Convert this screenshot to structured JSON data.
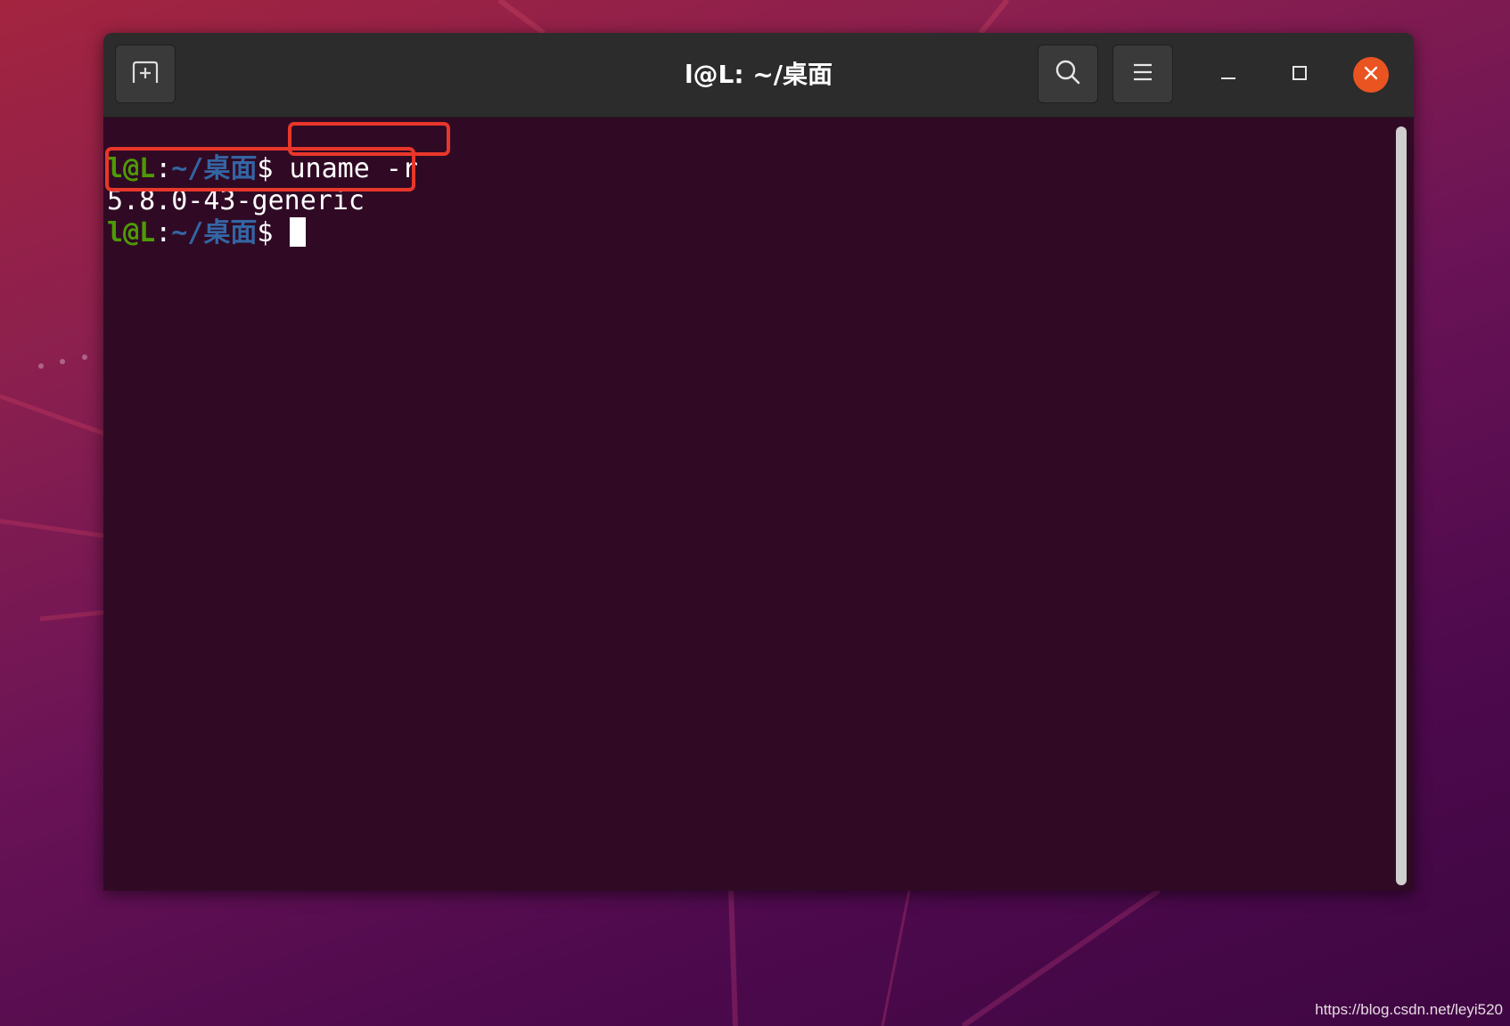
{
  "window": {
    "title": "l@L: ~/桌面"
  },
  "headerbar": {
    "icons": [
      "new-tab-icon",
      "search-icon",
      "hamburger-menu-icon",
      "minimize-icon",
      "maximize-icon",
      "close-icon"
    ],
    "close_color": "#e95420"
  },
  "terminal": {
    "colors": {
      "background": "#300a24",
      "user": "#4e9a06",
      "path": "#3465a4",
      "text": "#ffffff"
    },
    "lines": [
      {
        "user": "l@L",
        "sep": ":",
        "path": "~/桌面",
        "prompt": "$ ",
        "command": "uname -r"
      },
      {
        "output": "5.8.0-43-generic"
      },
      {
        "user": "l@L",
        "sep": ":",
        "path": "~/桌面",
        "prompt": "$ ",
        "command": ""
      }
    ]
  },
  "annotations": {
    "highlight_color": "#e8372a"
  },
  "watermark": "https://blog.csdn.net/leyi520"
}
